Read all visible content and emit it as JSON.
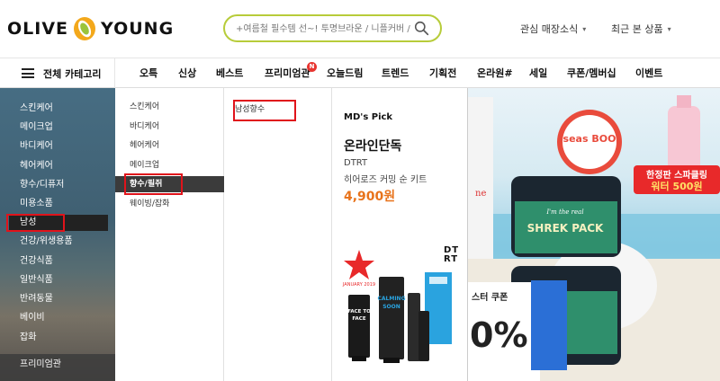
{
  "brand": {
    "logo_left": "OLIVE",
    "logo_right": "YOUNG",
    "colors": {
      "accent": "#b7cc3a",
      "logo_orange": "#f3a81b",
      "logo_green": "#9bc43b",
      "price": "#e8731b",
      "highlight": "#e0131b"
    }
  },
  "search": {
    "placeholder": "+여름철 필수템 선~! 투명브라운 / 니플커버 / 타...",
    "icon": "search-icon"
  },
  "utility": [
    {
      "label": "관심 매장소식"
    },
    {
      "label": "최근 본 상품"
    }
  ],
  "gnb": {
    "all_label": "전체 카테고리",
    "menu": [
      "오특",
      "신상",
      "베스트",
      "프리미엄관",
      "오늘드림",
      "트렌드",
      "기획전",
      "온라원#",
      "세일",
      "쿠폰/멤버십",
      "이벤트"
    ],
    "badge": "N"
  },
  "categories": {
    "level1": [
      "스킨케어",
      "메이크업",
      "바디케어",
      "헤어케어",
      "향수/디퓨저",
      "미용소품",
      "남성",
      "건강/위생용품",
      "건강식품",
      "일반식품",
      "반려동물",
      "베이비",
      "잡화",
      "프리미엄관"
    ],
    "level1_selected": "남성",
    "level2": [
      "스킨케어",
      "바디케어",
      "헤어케어",
      "메이크업",
      "향수/필쥐",
      "웨이빙/잡화"
    ],
    "level2_selected": "향수/필쥐",
    "level3": [
      "남성향수"
    ]
  },
  "md_pick": {
    "section_label": "MD's Pick",
    "product_title": "온라인단독",
    "brand": "DTRT",
    "description": "히어로즈 커밍 순 키트",
    "price": "4,900원",
    "logo_text": "DT RT",
    "package_texts": [
      "FACE TO FACE",
      "CALMING SOON",
      "JANUARY 2019"
    ]
  },
  "banner": {
    "promo_badge": "한정판 스파클링",
    "promo_price": "워터 500원",
    "product_name": "SHREK PACK",
    "product_sub": "I'm the real",
    "coupon_text": "스터 쿠폰",
    "percent": "0%",
    "seasonal": "seas BOO"
  }
}
